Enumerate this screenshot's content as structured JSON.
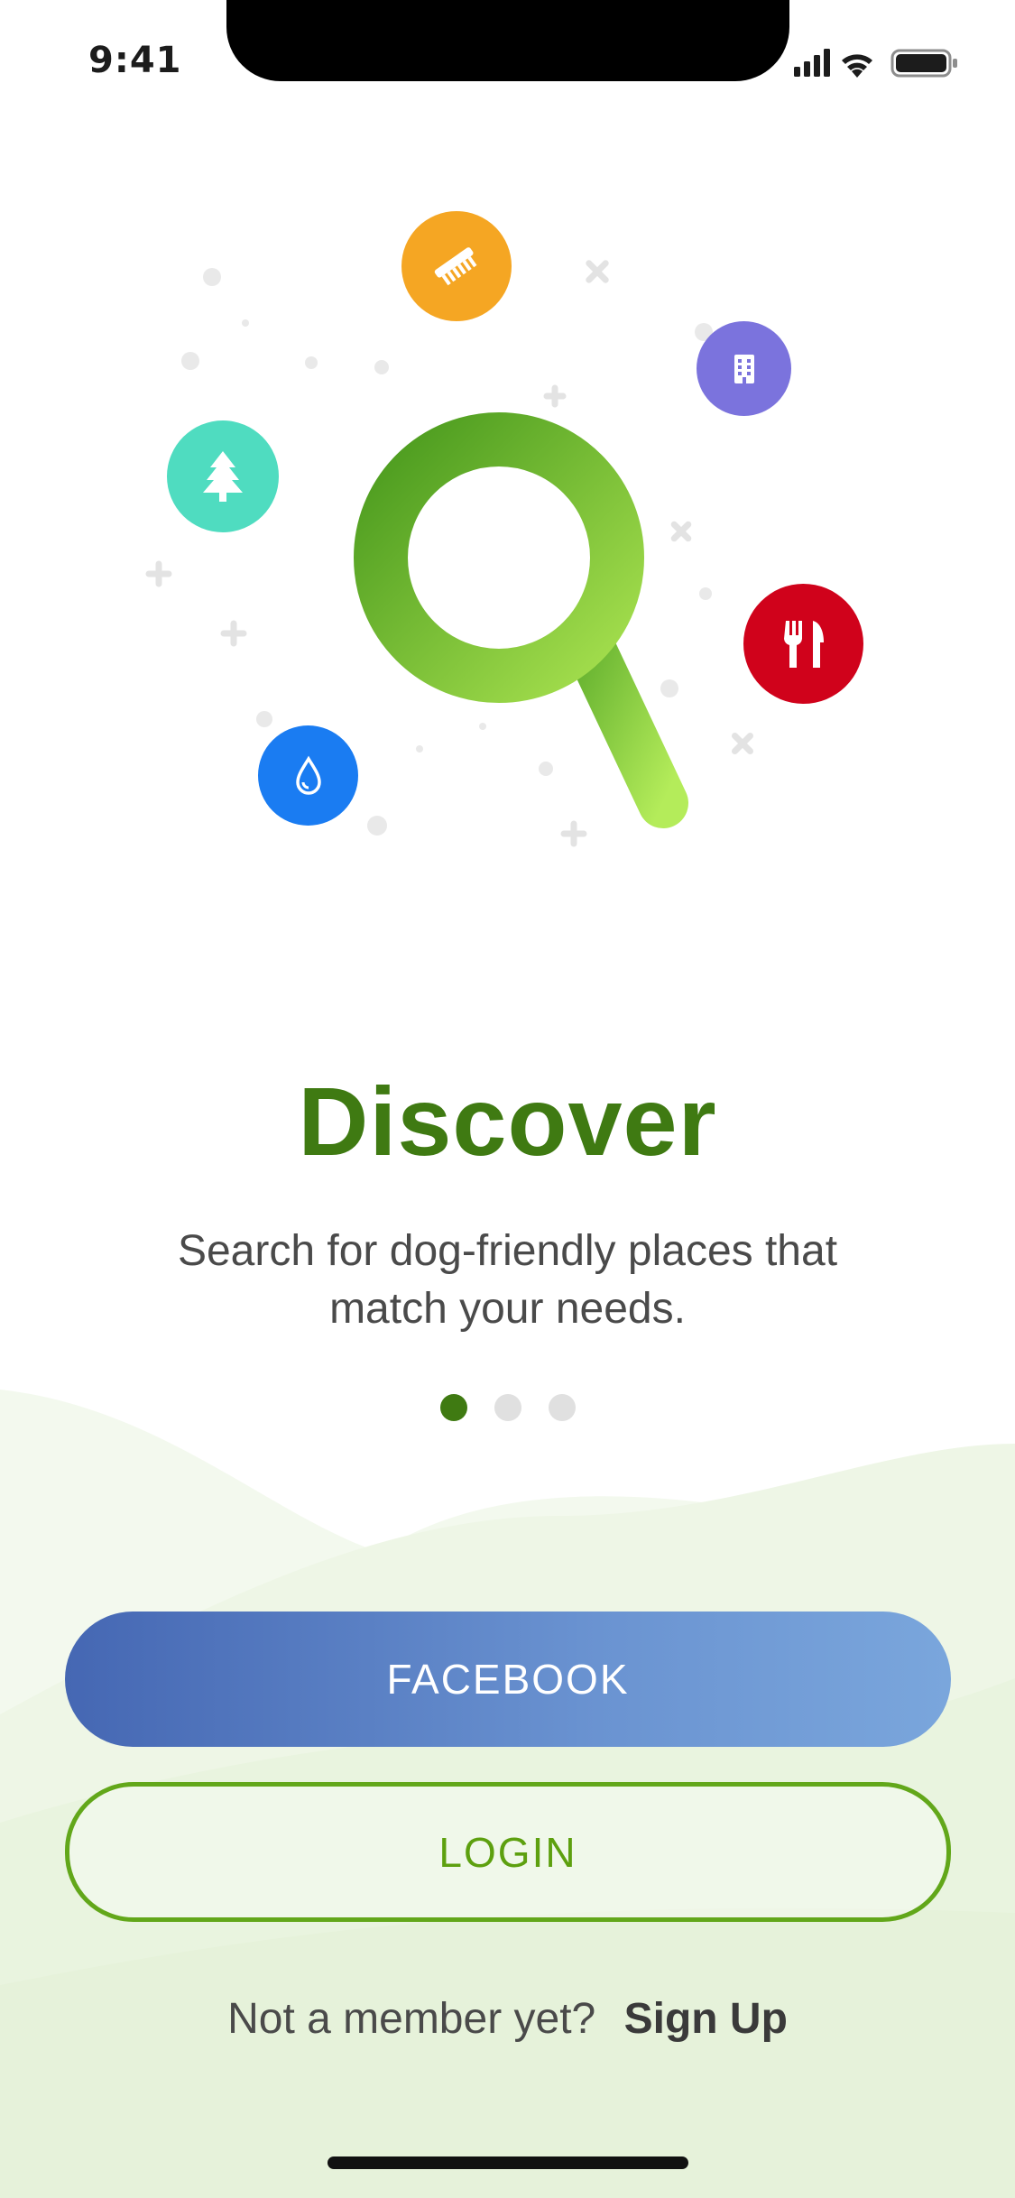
{
  "status_bar": {
    "time": "9:41"
  },
  "onboarding": {
    "title": "Discover",
    "subtitle": "Search for dog-friendly places that match your needs.",
    "pager": {
      "total": 3,
      "active_index": 0
    },
    "categories": [
      {
        "icon": "comb-icon",
        "color": "#F5A623"
      },
      {
        "icon": "building-icon",
        "color": "#7B73DD"
      },
      {
        "icon": "tree-icon",
        "color": "#4FDCC0"
      },
      {
        "icon": "fork-knife-icon",
        "color": "#D0021B"
      },
      {
        "icon": "water-drop-icon",
        "color": "#1A7CF2"
      }
    ]
  },
  "actions": {
    "facebook_label": "FACEBOOK",
    "login_label": "LOGIN"
  },
  "footer": {
    "prompt": "Not a member yet?",
    "signup_label": "Sign Up"
  },
  "colors": {
    "brand_green": "#3F7A12",
    "login_outline": "#62A71A",
    "facebook_start": "#4567B3",
    "facebook_end": "#7AA6DC"
  }
}
